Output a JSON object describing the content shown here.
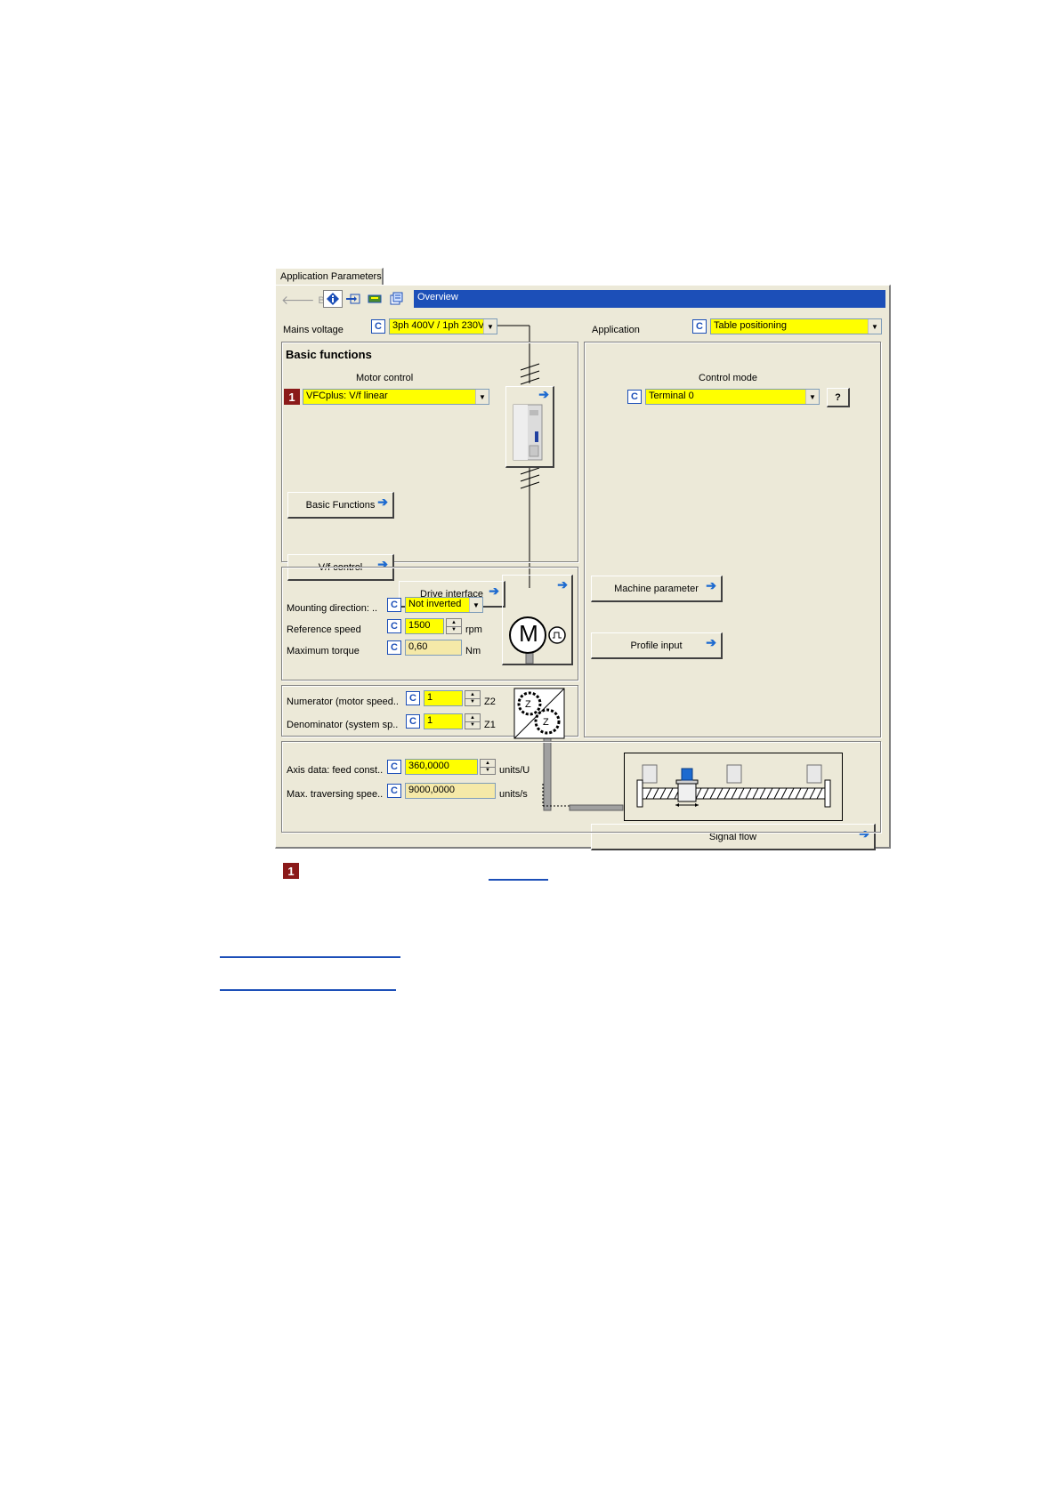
{
  "tab": {
    "label": "Application Parameters"
  },
  "toolbar": {
    "back_label": "Back",
    "icons": [
      "back-arrow-icon",
      "info-icon",
      "import-icon",
      "monitor-icon",
      "parameter-list-icon"
    ]
  },
  "nav": {
    "overview_label": "Overview"
  },
  "mains_voltage": {
    "label": "Mains voltage",
    "c": "C",
    "value": "3ph 400V / 1ph 230V"
  },
  "application": {
    "label": "Application",
    "c": "C",
    "value": "Table positioning"
  },
  "basic_functions": {
    "title": "Basic functions",
    "motor_control_label": "Motor control",
    "marker": "1",
    "motor_control_value": "VFCplus: V/f linear",
    "btn_basic_functions": "Basic Functions",
    "btn_vf_control": "V/f control",
    "btn_drive_interface": "Drive interface"
  },
  "control": {
    "mode_label": "Control mode",
    "c": "C",
    "mode_value": "Terminal 0",
    "help": "?",
    "btn_machine_parameter": "Machine parameter",
    "btn_profile_input": "Profile input",
    "btn_signal_flow": "Signal flow"
  },
  "motor": {
    "mounting_label": "Mounting direction: ..",
    "mounting_value": "Not inverted",
    "ref_speed_label": "Reference speed",
    "ref_speed_value": "1500",
    "ref_speed_unit": "rpm",
    "max_torque_label": "Maximum torque",
    "max_torque_value": "0,60",
    "max_torque_unit": "Nm",
    "c": "C",
    "motor_symbol": "M"
  },
  "gearbox": {
    "numerator_label": "Numerator (motor speed..",
    "numerator_value": "1",
    "numerator_unit": "Z2",
    "denominator_label": "Denominator (system sp..",
    "denominator_value": "1",
    "denominator_unit": "Z1",
    "c": "C"
  },
  "axis": {
    "feed_label": "Axis data: feed const..",
    "feed_value": "360,0000",
    "feed_unit": "units/U",
    "max_speed_label": "Max. traversing spee..",
    "max_speed_value": "9000,0000",
    "max_speed_unit": "units/s",
    "c": "C"
  },
  "footnote": {
    "marker": "1"
  }
}
